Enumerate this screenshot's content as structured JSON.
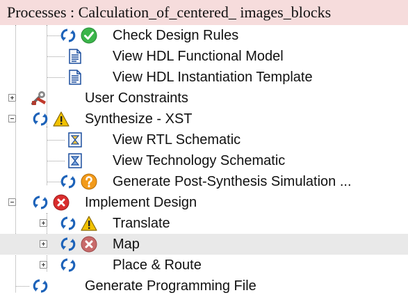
{
  "header": {
    "title": "Processes : Calculation_of_centered_ images_blocks"
  },
  "tree": {
    "rows": [
      {
        "label": "Check Design Rules",
        "status": "ok",
        "status_icon": "green-check-icon",
        "run_icon": "rerun-arrows-icon"
      },
      {
        "label": "View HDL Functional Model",
        "doc_icon": "document-icon"
      },
      {
        "label": "View HDL Instantiation Template",
        "doc_icon": "document-icon"
      },
      {
        "label": "User Constraints",
        "expander": "plus",
        "category_icon": "tools-icon"
      },
      {
        "label": "Synthesize - XST",
        "expander": "minus",
        "status": "warning",
        "status_icon": "warning-triangle-icon",
        "run_icon": "rerun-arrows-icon"
      },
      {
        "label": "View RTL Schematic",
        "doc_icon": "schematic-icon"
      },
      {
        "label": "View Technology Schematic",
        "doc_icon": "schematic-icon"
      },
      {
        "label": "Generate Post-Synthesis Simulation ...",
        "status": "unknown",
        "status_icon": "question-circle-icon",
        "run_icon": "rerun-arrows-icon"
      },
      {
        "label": "Implement Design",
        "expander": "minus",
        "status": "error",
        "status_icon": "error-circle-icon",
        "run_icon": "rerun-arrows-icon"
      },
      {
        "label": "Translate",
        "expander": "plus",
        "status": "warning",
        "status_icon": "warning-triangle-icon",
        "run_icon": "rerun-arrows-icon"
      },
      {
        "label": "Map",
        "expander": "plus",
        "status": "error",
        "status_icon": "error-circle-icon",
        "run_icon": "rerun-arrows-icon",
        "selected": true
      },
      {
        "label": "Place & Route",
        "expander": "plus",
        "run_icon": "rerun-arrows-icon"
      },
      {
        "label": "Generate Programming File",
        "run_icon": "rerun-arrows-icon"
      }
    ]
  },
  "colors": {
    "title_bg": "#f6dcdc",
    "arrows": "#1c62b9",
    "ok": "#3bb54a",
    "warning": "#f2c200",
    "error": "#d92d2d",
    "unknown": "#f29a1a",
    "selected_row": "#e9e9e9"
  }
}
